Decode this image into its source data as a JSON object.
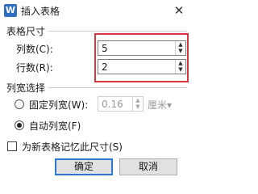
{
  "dialog": {
    "title": "插入表格",
    "app_icon_letter": "W"
  },
  "table_size": {
    "heading": "表格尺寸",
    "columns_label": "列数(C):",
    "columns_value": "5",
    "rows_label": "行数(R):",
    "rows_value": "2"
  },
  "column_width": {
    "heading": "列宽选择",
    "fixed_label": "固定列宽(W):",
    "fixed_value": "0.16",
    "unit": "厘米▾",
    "auto_label": "自动列宽(F)",
    "selected": "auto"
  },
  "remember": {
    "label": "为新表格记忆此尺寸(S)",
    "checked": false
  },
  "buttons": {
    "ok": "确定",
    "cancel": "取消"
  },
  "colors": {
    "highlight": "#d9373f",
    "primary_border": "#2d76d2"
  }
}
